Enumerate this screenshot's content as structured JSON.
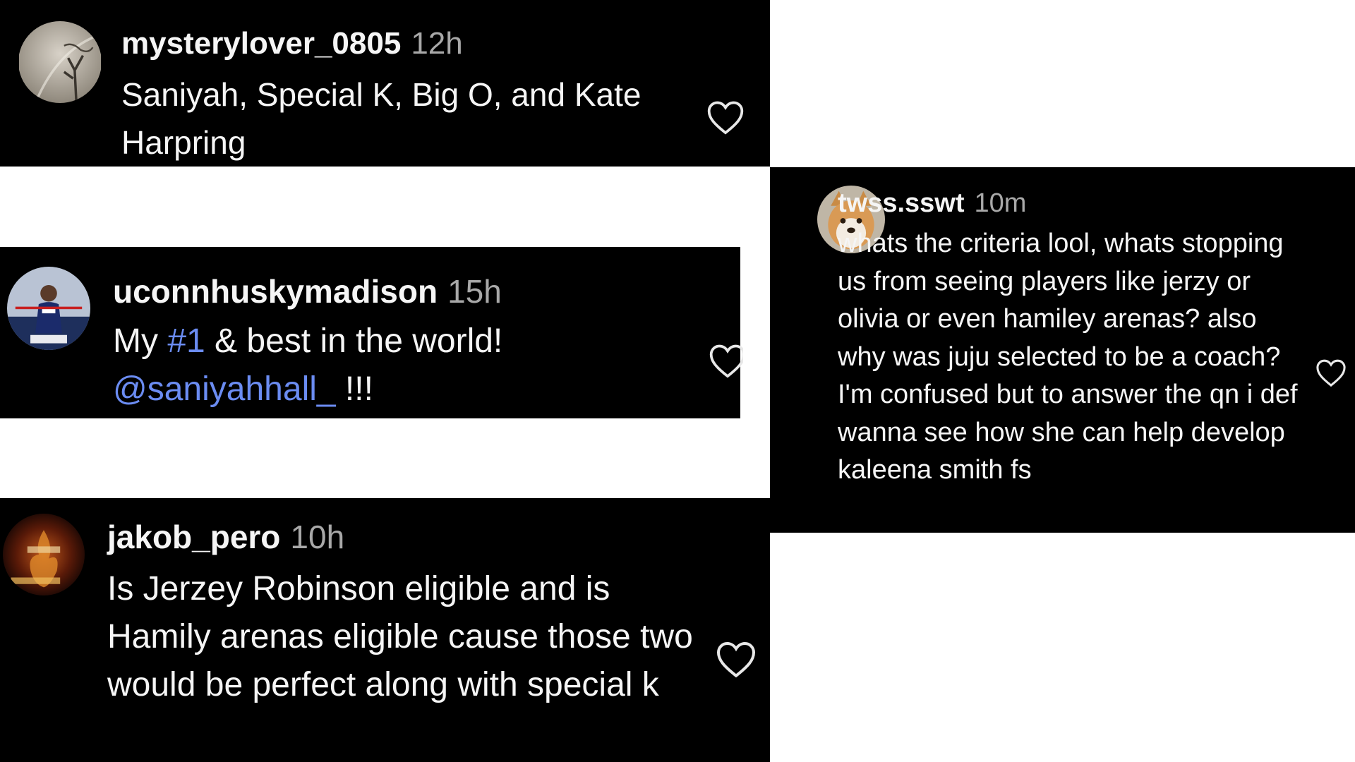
{
  "comments": [
    {
      "username": "mysterylover_0805",
      "time": "12h",
      "text": "Saniyah, Special K, Big O, and Kate Harpring",
      "avatar_icon": "landscape-avatar-icon",
      "like_icon": "heart-outline-icon"
    },
    {
      "username": "uconnhuskymadison",
      "time": "15h",
      "text_before": "My ",
      "hashtag": "#1",
      "text_middle": " & best in the world!",
      "mention": "@saniyahhall_",
      "text_after": " !!!",
      "avatar_icon": "basketball-player-avatar-icon",
      "like_icon": "heart-outline-icon"
    },
    {
      "username": "jakob_pero",
      "time": "10h",
      "text": "Is Jerzey Robinson eligible and is Hamily arenas eligible cause those two would be perfect along with special k",
      "avatar_icon": "flame-logo-avatar-icon",
      "like_icon": "heart-outline-icon"
    },
    {
      "username": "twss.sswt",
      "time": "10m",
      "text": "whats the criteria lool, whats stopping us from seeing players like jerzy or olivia or even hamiley arenas? also why was juju selected to be a coach? I'm confused but to answer the qn i def wanna see how she can help develop kaleena smith fs",
      "avatar_icon": "shiba-dog-avatar-icon",
      "like_icon": "heart-outline-icon"
    }
  ],
  "colors": {
    "card_bg": "#000000",
    "text": "#f5f5f5",
    "muted": "#a8a8a8",
    "link": "#6b8cf2",
    "page_bg": "#ffffff"
  }
}
